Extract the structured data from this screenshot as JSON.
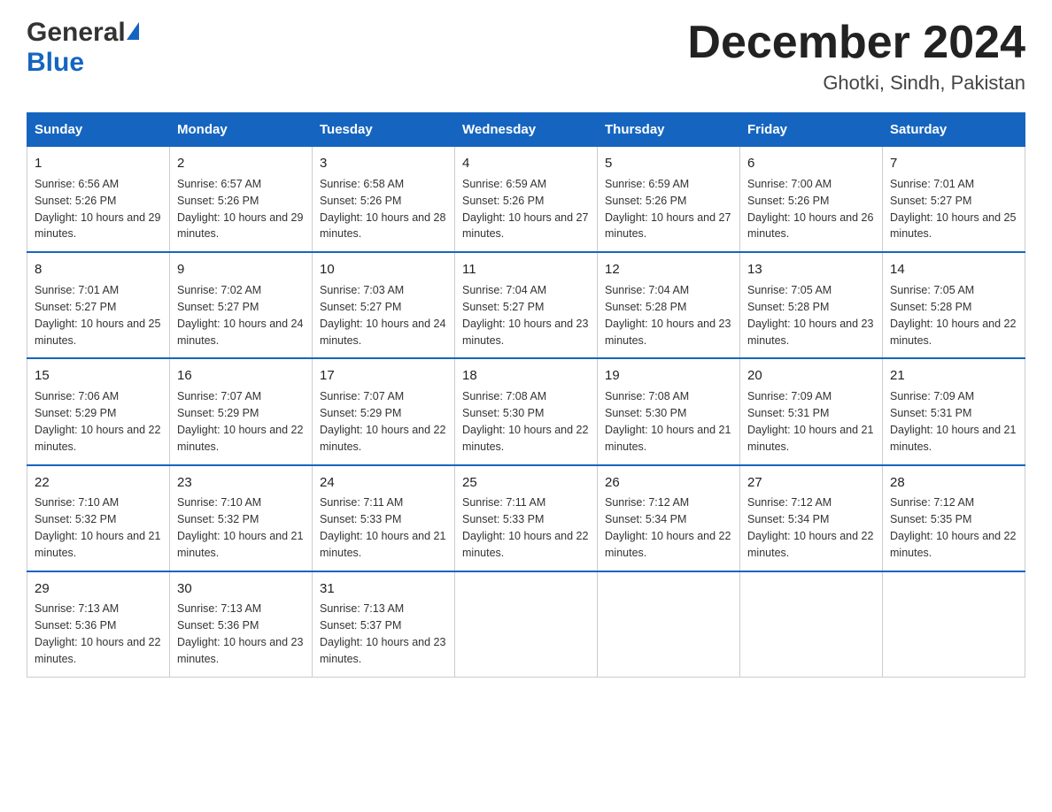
{
  "header": {
    "logo_general": "General",
    "logo_blue": "Blue",
    "month_title": "December 2024",
    "location": "Ghotki, Sindh, Pakistan"
  },
  "days_of_week": [
    "Sunday",
    "Monday",
    "Tuesday",
    "Wednesday",
    "Thursday",
    "Friday",
    "Saturday"
  ],
  "weeks": [
    [
      {
        "day": "1",
        "sunrise": "6:56 AM",
        "sunset": "5:26 PM",
        "daylight": "10 hours and 29 minutes."
      },
      {
        "day": "2",
        "sunrise": "6:57 AM",
        "sunset": "5:26 PM",
        "daylight": "10 hours and 29 minutes."
      },
      {
        "day": "3",
        "sunrise": "6:58 AM",
        "sunset": "5:26 PM",
        "daylight": "10 hours and 28 minutes."
      },
      {
        "day": "4",
        "sunrise": "6:59 AM",
        "sunset": "5:26 PM",
        "daylight": "10 hours and 27 minutes."
      },
      {
        "day": "5",
        "sunrise": "6:59 AM",
        "sunset": "5:26 PM",
        "daylight": "10 hours and 27 minutes."
      },
      {
        "day": "6",
        "sunrise": "7:00 AM",
        "sunset": "5:26 PM",
        "daylight": "10 hours and 26 minutes."
      },
      {
        "day": "7",
        "sunrise": "7:01 AM",
        "sunset": "5:27 PM",
        "daylight": "10 hours and 25 minutes."
      }
    ],
    [
      {
        "day": "8",
        "sunrise": "7:01 AM",
        "sunset": "5:27 PM",
        "daylight": "10 hours and 25 minutes."
      },
      {
        "day": "9",
        "sunrise": "7:02 AM",
        "sunset": "5:27 PM",
        "daylight": "10 hours and 24 minutes."
      },
      {
        "day": "10",
        "sunrise": "7:03 AM",
        "sunset": "5:27 PM",
        "daylight": "10 hours and 24 minutes."
      },
      {
        "day": "11",
        "sunrise": "7:04 AM",
        "sunset": "5:27 PM",
        "daylight": "10 hours and 23 minutes."
      },
      {
        "day": "12",
        "sunrise": "7:04 AM",
        "sunset": "5:28 PM",
        "daylight": "10 hours and 23 minutes."
      },
      {
        "day": "13",
        "sunrise": "7:05 AM",
        "sunset": "5:28 PM",
        "daylight": "10 hours and 23 minutes."
      },
      {
        "day": "14",
        "sunrise": "7:05 AM",
        "sunset": "5:28 PM",
        "daylight": "10 hours and 22 minutes."
      }
    ],
    [
      {
        "day": "15",
        "sunrise": "7:06 AM",
        "sunset": "5:29 PM",
        "daylight": "10 hours and 22 minutes."
      },
      {
        "day": "16",
        "sunrise": "7:07 AM",
        "sunset": "5:29 PM",
        "daylight": "10 hours and 22 minutes."
      },
      {
        "day": "17",
        "sunrise": "7:07 AM",
        "sunset": "5:29 PM",
        "daylight": "10 hours and 22 minutes."
      },
      {
        "day": "18",
        "sunrise": "7:08 AM",
        "sunset": "5:30 PM",
        "daylight": "10 hours and 22 minutes."
      },
      {
        "day": "19",
        "sunrise": "7:08 AM",
        "sunset": "5:30 PM",
        "daylight": "10 hours and 21 minutes."
      },
      {
        "day": "20",
        "sunrise": "7:09 AM",
        "sunset": "5:31 PM",
        "daylight": "10 hours and 21 minutes."
      },
      {
        "day": "21",
        "sunrise": "7:09 AM",
        "sunset": "5:31 PM",
        "daylight": "10 hours and 21 minutes."
      }
    ],
    [
      {
        "day": "22",
        "sunrise": "7:10 AM",
        "sunset": "5:32 PM",
        "daylight": "10 hours and 21 minutes."
      },
      {
        "day": "23",
        "sunrise": "7:10 AM",
        "sunset": "5:32 PM",
        "daylight": "10 hours and 21 minutes."
      },
      {
        "day": "24",
        "sunrise": "7:11 AM",
        "sunset": "5:33 PM",
        "daylight": "10 hours and 21 minutes."
      },
      {
        "day": "25",
        "sunrise": "7:11 AM",
        "sunset": "5:33 PM",
        "daylight": "10 hours and 22 minutes."
      },
      {
        "day": "26",
        "sunrise": "7:12 AM",
        "sunset": "5:34 PM",
        "daylight": "10 hours and 22 minutes."
      },
      {
        "day": "27",
        "sunrise": "7:12 AM",
        "sunset": "5:34 PM",
        "daylight": "10 hours and 22 minutes."
      },
      {
        "day": "28",
        "sunrise": "7:12 AM",
        "sunset": "5:35 PM",
        "daylight": "10 hours and 22 minutes."
      }
    ],
    [
      {
        "day": "29",
        "sunrise": "7:13 AM",
        "sunset": "5:36 PM",
        "daylight": "10 hours and 22 minutes."
      },
      {
        "day": "30",
        "sunrise": "7:13 AM",
        "sunset": "5:36 PM",
        "daylight": "10 hours and 23 minutes."
      },
      {
        "day": "31",
        "sunrise": "7:13 AM",
        "sunset": "5:37 PM",
        "daylight": "10 hours and 23 minutes."
      },
      null,
      null,
      null,
      null
    ]
  ]
}
